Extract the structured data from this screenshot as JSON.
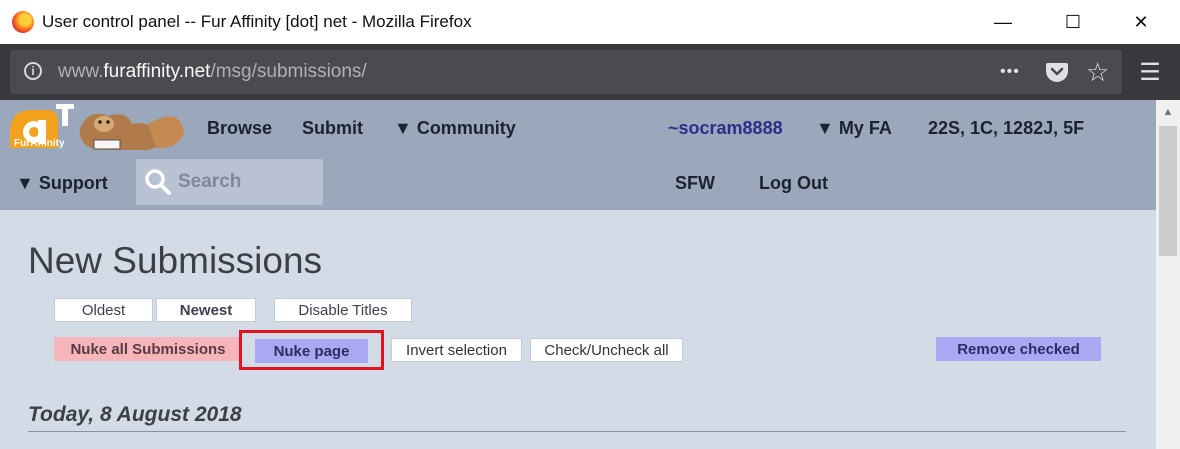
{
  "window": {
    "title": "User control panel -- Fur Affinity [dot] net - Mozilla Firefox",
    "minimize_icon": "—",
    "maximize_icon": "☐",
    "close_icon": "✕"
  },
  "browser": {
    "url_prefix": "www.",
    "url_host": "furaffinity.net",
    "url_path": "/msg/submissions/",
    "more_icon": "•••",
    "star_icon": "☆",
    "menu_icon": "☰"
  },
  "site": {
    "logo_text": "FurAffinity",
    "nav": {
      "browse": "Browse",
      "submit": "Submit",
      "community": "▼ Community",
      "username": "~socram8888",
      "my_fa": "▼ My FA",
      "notifications": "22S, 1C, 1282J, 5F",
      "support": "▼ Support",
      "sfw": "SFW",
      "logout": "Log Out"
    },
    "search": {
      "placeholder": "Search"
    }
  },
  "content": {
    "page_title": "New Submissions",
    "sort": {
      "oldest": "Oldest",
      "newest": "Newest",
      "disable_titles": "Disable Titles"
    },
    "actions": {
      "nuke_all": "Nuke all Submissions",
      "nuke_page": "Nuke page",
      "invert": "Invert selection",
      "check_all": "Check/Uncheck all",
      "remove_checked": "Remove checked"
    },
    "date_heading": "Today, 8 August 2018"
  },
  "colors": {
    "header_bg": "#9ba7bb",
    "page_bg": "#d3dbe7",
    "nuke_all_bg": "#f6b4bb",
    "nuke_page_bg": "#a9a9f3",
    "highlight": "#e0141e"
  }
}
